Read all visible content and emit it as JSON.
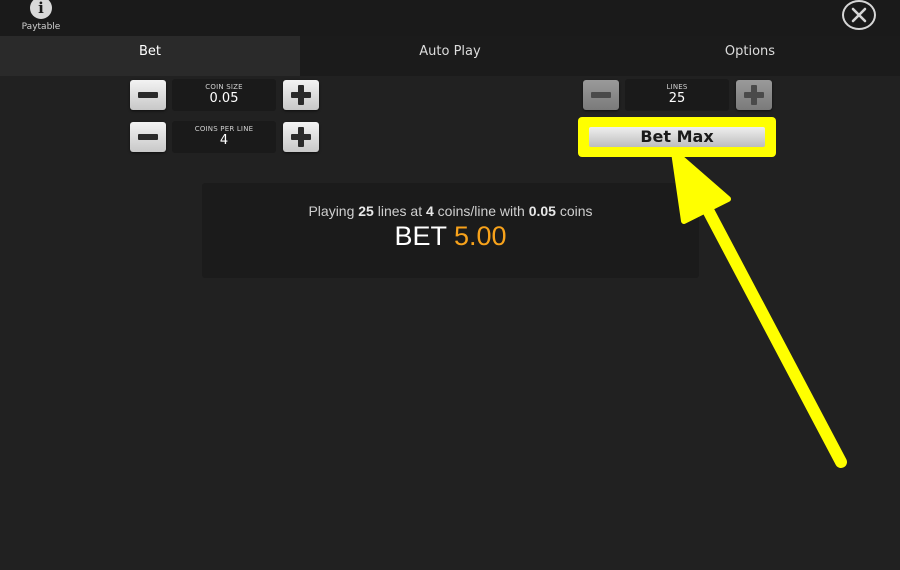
{
  "header": {
    "paytable_label": "Paytable",
    "paytable_icon": "info-icon",
    "close_icon": "close-icon"
  },
  "tabs": [
    {
      "label": "Bet",
      "active": true
    },
    {
      "label": "Auto Play",
      "active": false
    },
    {
      "label": "Options",
      "active": false
    }
  ],
  "bet_panel": {
    "coin_size": {
      "label": "COIN SIZE",
      "value": "0.05"
    },
    "coins_per_line": {
      "label": "COINS PER LINE",
      "value": "4"
    },
    "lines": {
      "label": "LINES",
      "value": "25"
    },
    "bet_max_label": "Bet Max"
  },
  "summary": {
    "prefix": "Playing",
    "lines": "25",
    "mid1": "lines at",
    "coins_per_line": "4",
    "mid2": "coins/line with",
    "coin_size": "0.05",
    "suffix": "coins",
    "bet_label": "BET",
    "bet_value": "5.00"
  },
  "colors": {
    "background": "#212121",
    "bet_value": "#f7a21b",
    "highlight": "#ffff00"
  }
}
